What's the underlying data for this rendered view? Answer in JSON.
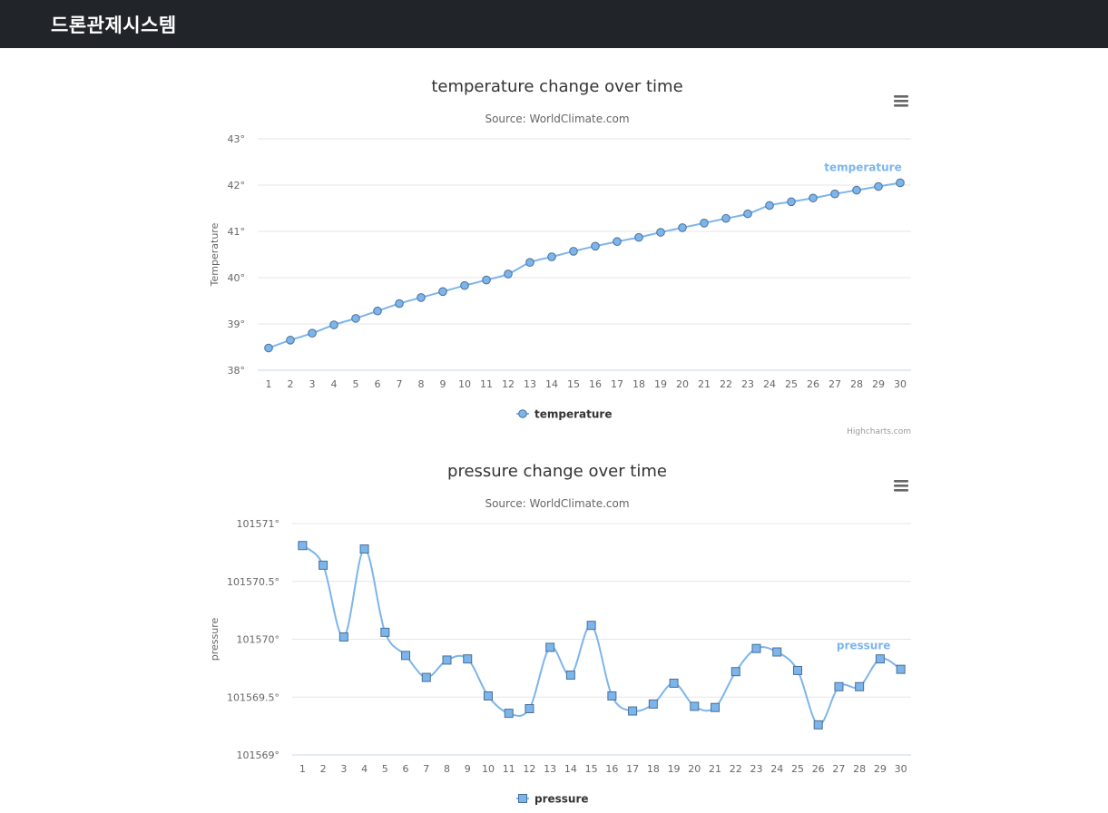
{
  "navbar": {
    "brand": "드론관제시스템"
  },
  "colors": {
    "series": "#7cb5ec",
    "marker_stroke": "#4a6f94",
    "grid": "#e6e6e6",
    "axis": "#ccd6eb",
    "text": "#333333",
    "muted": "#666666"
  },
  "chart_data": [
    {
      "type": "line",
      "title": "temperature change over time",
      "subtitle": "Source: WorldClimate.com",
      "ylabel": "Temperature",
      "xlabel": "",
      "categories": [
        "1",
        "2",
        "3",
        "4",
        "5",
        "6",
        "7",
        "8",
        "9",
        "10",
        "11",
        "12",
        "13",
        "14",
        "15",
        "16",
        "17",
        "18",
        "19",
        "20",
        "21",
        "22",
        "23",
        "24",
        "25",
        "26",
        "27",
        "28",
        "29",
        "30"
      ],
      "ylim": [
        38,
        43
      ],
      "yticks": [
        "38°",
        "39°",
        "40°",
        "41°",
        "42°",
        "43°"
      ],
      "grid": true,
      "legend_position": "bottom-center",
      "marker": "circle",
      "credits": "Highcharts.com",
      "series": [
        {
          "name": "temperature",
          "values": [
            38.48,
            38.65,
            38.8,
            38.98,
            39.12,
            39.28,
            39.44,
            39.57,
            39.7,
            39.83,
            39.95,
            40.08,
            40.33,
            40.45,
            40.57,
            40.68,
            40.78,
            40.87,
            40.98,
            41.08,
            41.18,
            41.28,
            41.38,
            41.56,
            41.64,
            41.72,
            41.81,
            41.89,
            41.97,
            42.05
          ]
        }
      ]
    },
    {
      "type": "line",
      "title": "pressure change over time",
      "subtitle": "Source: WorldClimate.com",
      "ylabel": "pressure",
      "xlabel": "",
      "categories": [
        "1",
        "2",
        "3",
        "4",
        "5",
        "6",
        "7",
        "8",
        "9",
        "10",
        "11",
        "12",
        "13",
        "14",
        "15",
        "16",
        "17",
        "18",
        "19",
        "20",
        "21",
        "22",
        "23",
        "24",
        "25",
        "26",
        "27",
        "28",
        "29",
        "30"
      ],
      "ylim": [
        101569,
        101571
      ],
      "yticks": [
        "101569°",
        "101569.5°",
        "101570°",
        "101570.5°",
        "101571°"
      ],
      "grid": true,
      "legend_position": "bottom-center",
      "marker": "square",
      "series": [
        {
          "name": "pressure",
          "values": [
            101570.81,
            101570.64,
            101570.02,
            101570.78,
            101570.06,
            101569.86,
            101569.67,
            101569.82,
            101569.83,
            101569.51,
            101569.36,
            101569.4,
            101569.93,
            101569.69,
            101570.12,
            101569.51,
            101569.38,
            101569.44,
            101569.62,
            101569.42,
            101569.41,
            101569.72,
            101569.92,
            101569.89,
            101569.73,
            101569.26,
            101569.59,
            101569.59,
            101569.83,
            101569.74
          ]
        }
      ]
    }
  ]
}
